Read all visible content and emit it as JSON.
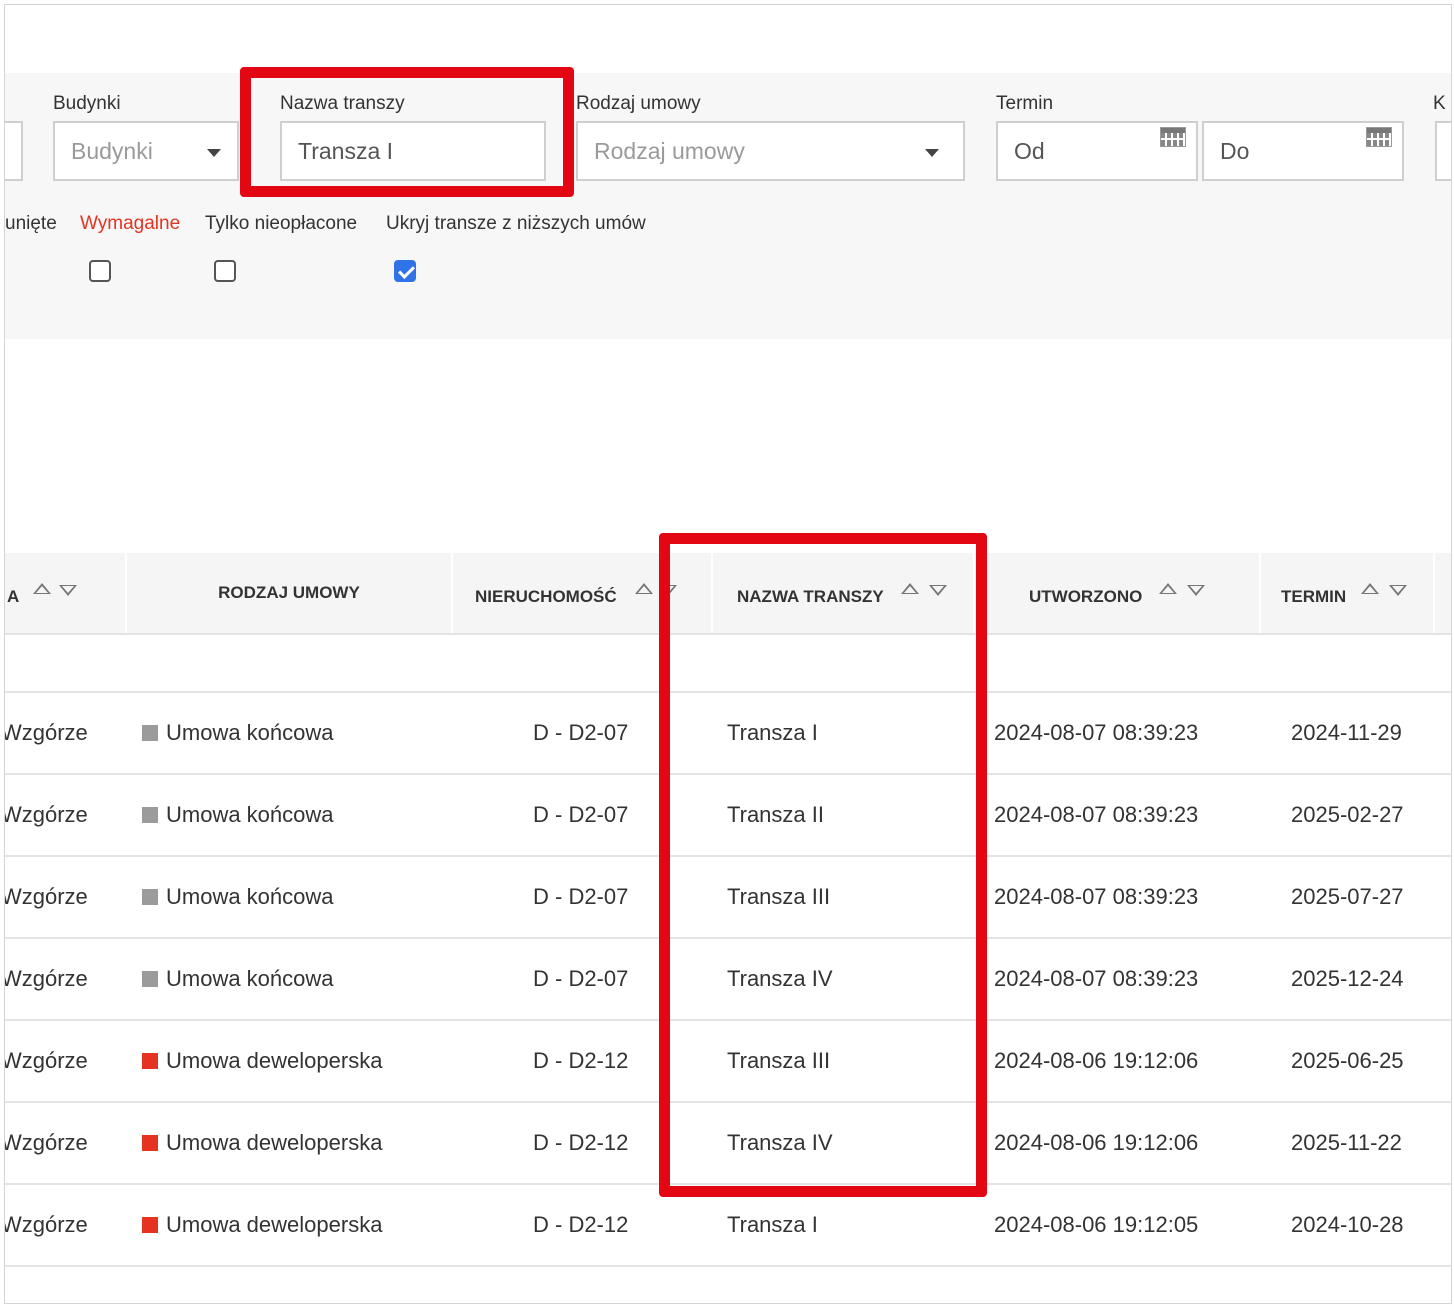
{
  "filters": {
    "buildings": {
      "label": "Budynki",
      "placeholder": "Budynki"
    },
    "tranche_name": {
      "label": "Nazwa transzy",
      "value": "Transza I"
    },
    "contract_type": {
      "label": "Rodzaj umowy",
      "placeholder": "Rodzaj umowy"
    },
    "due_date": {
      "label": "Termin",
      "from_placeholder": "Od",
      "to_placeholder": "Do"
    },
    "cut_label": "K",
    "checkboxes": {
      "cut_label": "unięte",
      "due": {
        "label": "Wymagalne",
        "checked": false
      },
      "unpaid_only": {
        "label": "Tylko nieopłacone",
        "checked": false
      },
      "hide_lower": {
        "label": "Ukryj transze z niższych umów",
        "checked": true
      }
    }
  },
  "table": {
    "columns": {
      "first_partial": "A",
      "contract_type": "RODZAJ UMOWY",
      "property": "NIERUCHOMOŚĆ",
      "tranche_name": "NAZWA TRANSZY",
      "created": "UTWORZONO",
      "due": "TERMIN"
    },
    "rows": [
      {
        "investment": "Wzgórze",
        "contract_type": "Umowa końcowa",
        "contract_color": "#9b9b9b",
        "property": "D - D2-07",
        "tranche": "Transza I",
        "created": "2024-08-07 08:39:23",
        "due": "2024-11-29"
      },
      {
        "investment": "Wzgórze",
        "contract_type": "Umowa końcowa",
        "contract_color": "#9b9b9b",
        "property": "D - D2-07",
        "tranche": "Transza II",
        "created": "2024-08-07 08:39:23",
        "due": "2025-02-27"
      },
      {
        "investment": "Wzgórze",
        "contract_type": "Umowa końcowa",
        "contract_color": "#9b9b9b",
        "property": "D - D2-07",
        "tranche": "Transza III",
        "created": "2024-08-07 08:39:23",
        "due": "2025-07-27"
      },
      {
        "investment": "Wzgórze",
        "contract_type": "Umowa końcowa",
        "contract_color": "#9b9b9b",
        "property": "D - D2-07",
        "tranche": "Transza IV",
        "created": "2024-08-07 08:39:23",
        "due": "2025-12-24"
      },
      {
        "investment": "Wzgórze",
        "contract_type": "Umowa deweloperska",
        "contract_color": "#e53323",
        "property": "D - D2-12",
        "tranche": "Transza III",
        "created": "2024-08-06 19:12:06",
        "due": "2025-06-25"
      },
      {
        "investment": "Wzgórze",
        "contract_type": "Umowa deweloperska",
        "contract_color": "#e53323",
        "property": "D - D2-12",
        "tranche": "Transza IV",
        "created": "2024-08-06 19:12:06",
        "due": "2025-11-22"
      },
      {
        "investment": "Wzgórze",
        "contract_type": "Umowa deweloperska",
        "contract_color": "#e53323",
        "property": "D - D2-12",
        "tranche": "Transza I",
        "created": "2024-08-06 19:12:05",
        "due": "2024-10-28"
      }
    ]
  },
  "colors": {
    "highlight": "#e30613",
    "checkbox_checked": "#2f73e6",
    "due_label": "#e53323"
  }
}
